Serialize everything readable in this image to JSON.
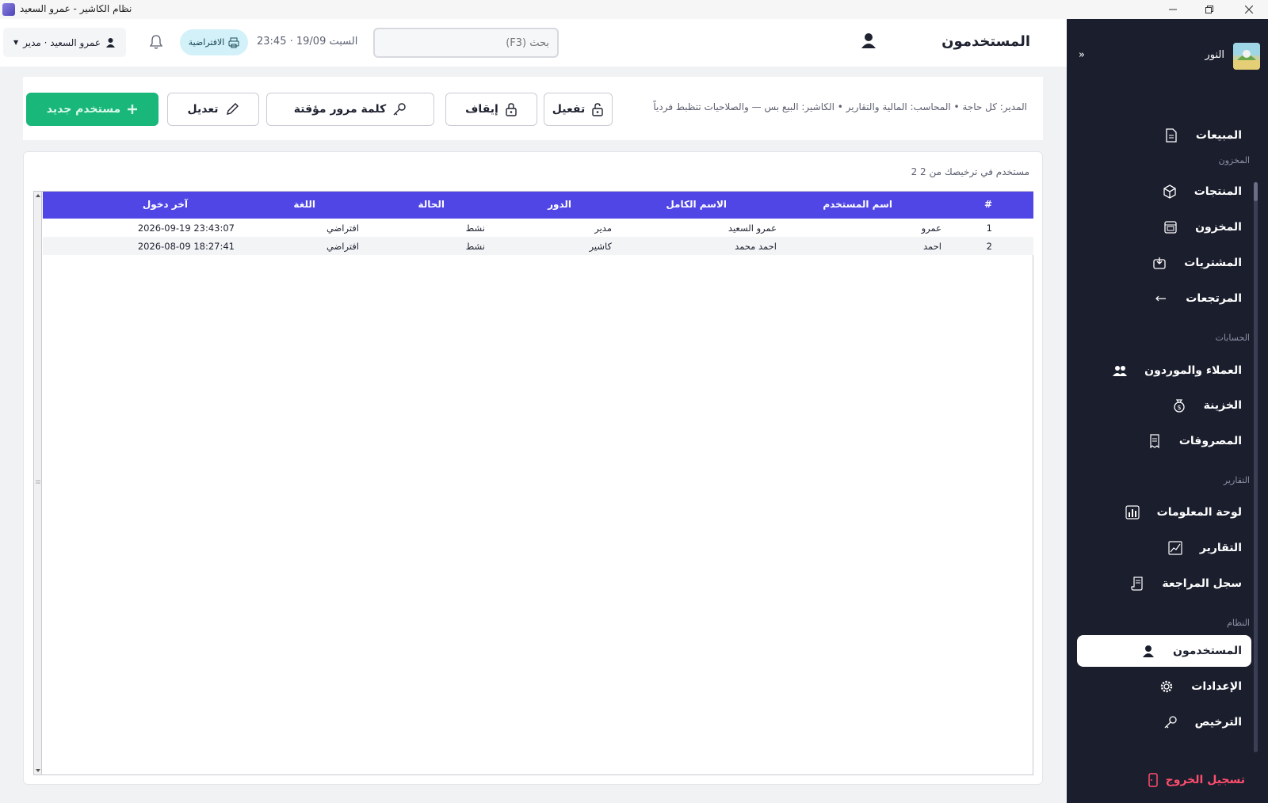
{
  "window": {
    "title": "نظام الكاشير - عمرو السعيد"
  },
  "sidebar": {
    "brand": "النور",
    "items": [
      {
        "label": "المبيعات",
        "icon": "document-icon"
      },
      {
        "label": "المنتجات",
        "icon": "box-icon"
      },
      {
        "label": "المخزون",
        "icon": "warehouse-icon"
      },
      {
        "label": "المشتريات",
        "icon": "purchase-icon"
      },
      {
        "label": "المرتجعات",
        "icon": "arrow-left-icon"
      },
      {
        "label": "العملاء والموردون",
        "icon": "users-icon"
      },
      {
        "label": "الخزينة",
        "icon": "money-bag-icon"
      },
      {
        "label": "المصروفات",
        "icon": "receipt-icon"
      },
      {
        "label": "لوحة المعلومات",
        "icon": "bar-chart-icon"
      },
      {
        "label": "التقارير",
        "icon": "line-chart-icon"
      },
      {
        "label": "سجل المراجعة",
        "icon": "scroll-icon"
      },
      {
        "label": "المستخدمون",
        "icon": "user-icon"
      },
      {
        "label": "الإعدادات",
        "icon": "gear-icon"
      },
      {
        "label": "الترخيص",
        "icon": "key-icon"
      }
    ],
    "sections": {
      "inventory": "المخزون",
      "accounts": "الحسابات",
      "reports": "التقارير",
      "system": "النظام"
    },
    "logout": "تسجيل الخروج"
  },
  "header": {
    "title": "المستخدمون",
    "search_placeholder": "بحث (F3)",
    "clock": "السبت 19/09 · 23:45",
    "printer": "الافتراضية",
    "user_menu": "عمرو السعيد · مدير"
  },
  "toolbar": {
    "hint": "المدير: كل حاجة • المحاسب: المالية والتقارير • الكاشير: البيع بس — والصلاحيات تتظبط فردياً",
    "activate": "تفعيل",
    "suspend": "إيقاف",
    "temp_password": "كلمة مرور مؤقتة",
    "edit": "تعديل",
    "new_user": "مستخدم جديد"
  },
  "table": {
    "count_label": "2 مستخدم في ترخيصك من 2",
    "columns": [
      "#",
      "اسم المستخدم",
      "الاسم الكامل",
      "الدور",
      "الحالة",
      "اللغة",
      "آخر دخول"
    ],
    "rows": [
      [
        "1",
        "عمرو",
        "عمرو السعيد",
        "مدير",
        "نشط",
        "افتراضي",
        "2026-09-19 23:43:07"
      ],
      [
        "2",
        "احمد",
        "احمد محمد",
        "كاشير",
        "نشط",
        "افتراضي",
        "2026-08-09 18:27:41"
      ]
    ]
  },
  "colors": {
    "accent": "#5046e5",
    "sidebar_bg": "#1b1e2d",
    "success": "#19b77a",
    "danger": "#ff4d6d"
  }
}
